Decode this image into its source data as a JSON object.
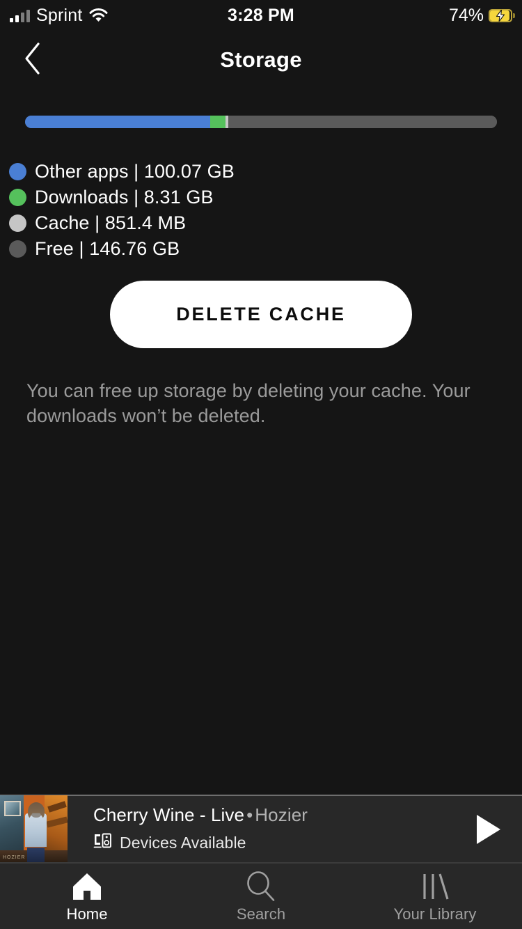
{
  "statusbar": {
    "carrier": "Sprint",
    "signal_icon": "cellular-signal-icon",
    "wifi_icon": "wifi-icon",
    "time": "3:28 PM",
    "battery_percent": "74%",
    "battery_icon": "battery-charging-icon"
  },
  "header": {
    "back_icon": "chevron-left-icon",
    "title": "Storage"
  },
  "storage": {
    "bar": {
      "segments": [
        {
          "name": "Other apps",
          "color": "#4a7fd4",
          "percent": 39.2
        },
        {
          "name": "Downloads",
          "color": "#55c15c",
          "percent": 3.3
        },
        {
          "name": "Cache",
          "color": "#c6c6c6",
          "percent": 0.6
        },
        {
          "name": "Free",
          "color": "#5a5a5a",
          "percent": 56.9
        }
      ]
    },
    "legend": [
      {
        "label": "Other apps | 100.07 GB",
        "color": "#4a7fd4",
        "dot": "legend-dot-other-apps"
      },
      {
        "label": "Downloads | 8.31 GB",
        "color": "#55c15c",
        "dot": "legend-dot-downloads"
      },
      {
        "label": "Cache | 851.4 MB",
        "color": "#c6c6c6",
        "dot": "legend-dot-cache"
      },
      {
        "label": "Free | 146.76 GB",
        "color": "#5a5a5a",
        "dot": "legend-dot-free"
      }
    ],
    "delete_button": "DELETE CACHE",
    "hint": "You can free up storage by deleting your cache. Your downloads won’t be deleted."
  },
  "nowplaying": {
    "album_art": "album-artwork",
    "track": "Cherry Wine - Live",
    "separator": "•",
    "artist": "Hozier",
    "devices_icon": "cast-devices-icon",
    "devices_label": "Devices Available",
    "play_icon": "play-icon"
  },
  "tabbar": {
    "tabs": [
      {
        "label": "Home",
        "icon": "home-icon",
        "active": true
      },
      {
        "label": "Search",
        "icon": "search-icon",
        "active": false
      },
      {
        "label": "Your Library",
        "icon": "library-icon",
        "active": false
      }
    ]
  }
}
